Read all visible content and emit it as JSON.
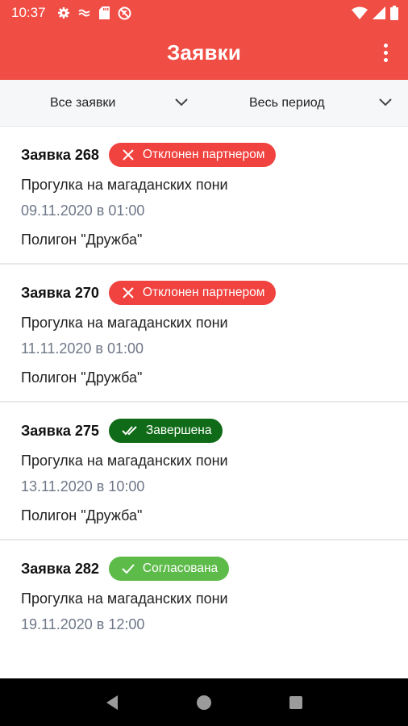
{
  "status_bar": {
    "time": "10:37",
    "left_icons": [
      "gear-icon",
      "vpn-icon",
      "sd-card-icon",
      "no-disturb-icon"
    ],
    "right_icons": [
      "wifi-icon",
      "signal-icon",
      "battery-icon"
    ]
  },
  "app_bar": {
    "title": "Заявки",
    "menu_icon": "more-vert-icon",
    "background_color": "#f04e45"
  },
  "filters": {
    "status_filter": "Все заявки",
    "period_filter": "Весь период"
  },
  "requests": [
    {
      "title": "Заявка 268",
      "status": "Отклонен партнером",
      "status_icon": "x-icon",
      "status_color": "#f0423e",
      "activity": "Прогулка на магаданских пони",
      "datetime": "09.11.2020 в 01:00",
      "place": "Полигон \"Дружба\""
    },
    {
      "title": "Заявка 270",
      "status": "Отклонен партнером",
      "status_icon": "x-icon",
      "status_color": "#f0423e",
      "activity": "Прогулка на магаданских пони",
      "datetime": "11.11.2020 в 01:00",
      "place": "Полигон \"Дружба\""
    },
    {
      "title": "Заявка 275",
      "status": "Завершена",
      "status_icon": "double-check-icon",
      "status_color": "#0f6b17",
      "activity": "Прогулка на магаданских пони",
      "datetime": "13.11.2020 в 10:00",
      "place": "Полигон \"Дружба\""
    },
    {
      "title": "Заявка 282",
      "status": "Согласована",
      "status_icon": "check-icon",
      "status_color": "#5dbb4a",
      "activity": "Прогулка на магаданских пони",
      "datetime": "19.11.2020 в 12:00",
      "place": ""
    }
  ],
  "nav_bar": {
    "buttons": [
      "back-triangle-icon",
      "home-circle-icon",
      "recents-square-icon"
    ]
  }
}
